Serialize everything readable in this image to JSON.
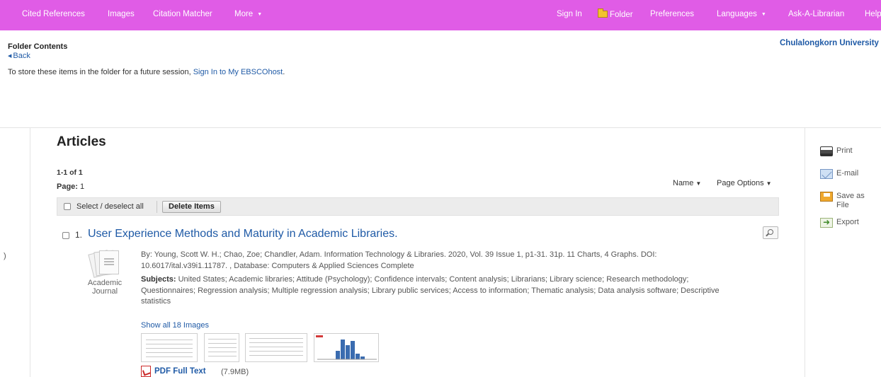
{
  "nav": {
    "left_items": [
      "Cited References",
      "Images",
      "Citation Matcher",
      "More"
    ],
    "right_items": [
      "Sign In",
      "Folder",
      "Preferences",
      "Languages",
      "Ask-A-Librarian",
      "Help"
    ]
  },
  "header": {
    "title": "Folder Contents",
    "back": "Back",
    "store_msg_prefix": "To store these items in the folder for a future session, ",
    "store_msg_link": "Sign In to My EBSCOhost",
    "store_msg_suffix": ".",
    "institution": "Chulalongkorn University"
  },
  "articles": {
    "heading": "Articles",
    "count": "1-1 of 1",
    "page_label": "Page:",
    "page_value": "1",
    "sort_label": "Name",
    "page_options_label": "Page Options",
    "select_all_label": "Select / deselect all",
    "delete_button": "Delete Items"
  },
  "result": {
    "number": "1.",
    "title": "User Experience Methods and Maturity in Academic Libraries.",
    "pub_type": "Academic Journal",
    "byline": "By: Young, Scott W. H.; Chao, Zoe; Chandler, Adam. Information Technology & Libraries. 2020, Vol. 39 Issue 1, p1-31. 31p. 11 Charts, 4 Graphs. DOI: 10.6017/ital.v39i1.11787. , Database: Computers & Applied Sciences Complete",
    "subjects_label": "Subjects:",
    "subjects": "United States; Academic libraries; Attitude (Psychology); Confidence intervals; Content analysis; Librarians; Library science; Research methodology; Questionnaires; Regression analysis; Multiple regression analysis; Library public services; Access to information; Thematic analysis; Data analysis software; Descriptive statistics",
    "show_images": "Show all 18 Images",
    "pdf_label": "PDF Full Text",
    "pdf_size": "(7.9MB)"
  },
  "tools": {
    "print": "Print",
    "email": "E-mail",
    "save": "Save as File",
    "export": "Export"
  },
  "stray_char": ")",
  "colors": {
    "nav_bg": "#e05ce6",
    "link": "#1f5aa6",
    "chart_bar": "#3a6cb0"
  }
}
